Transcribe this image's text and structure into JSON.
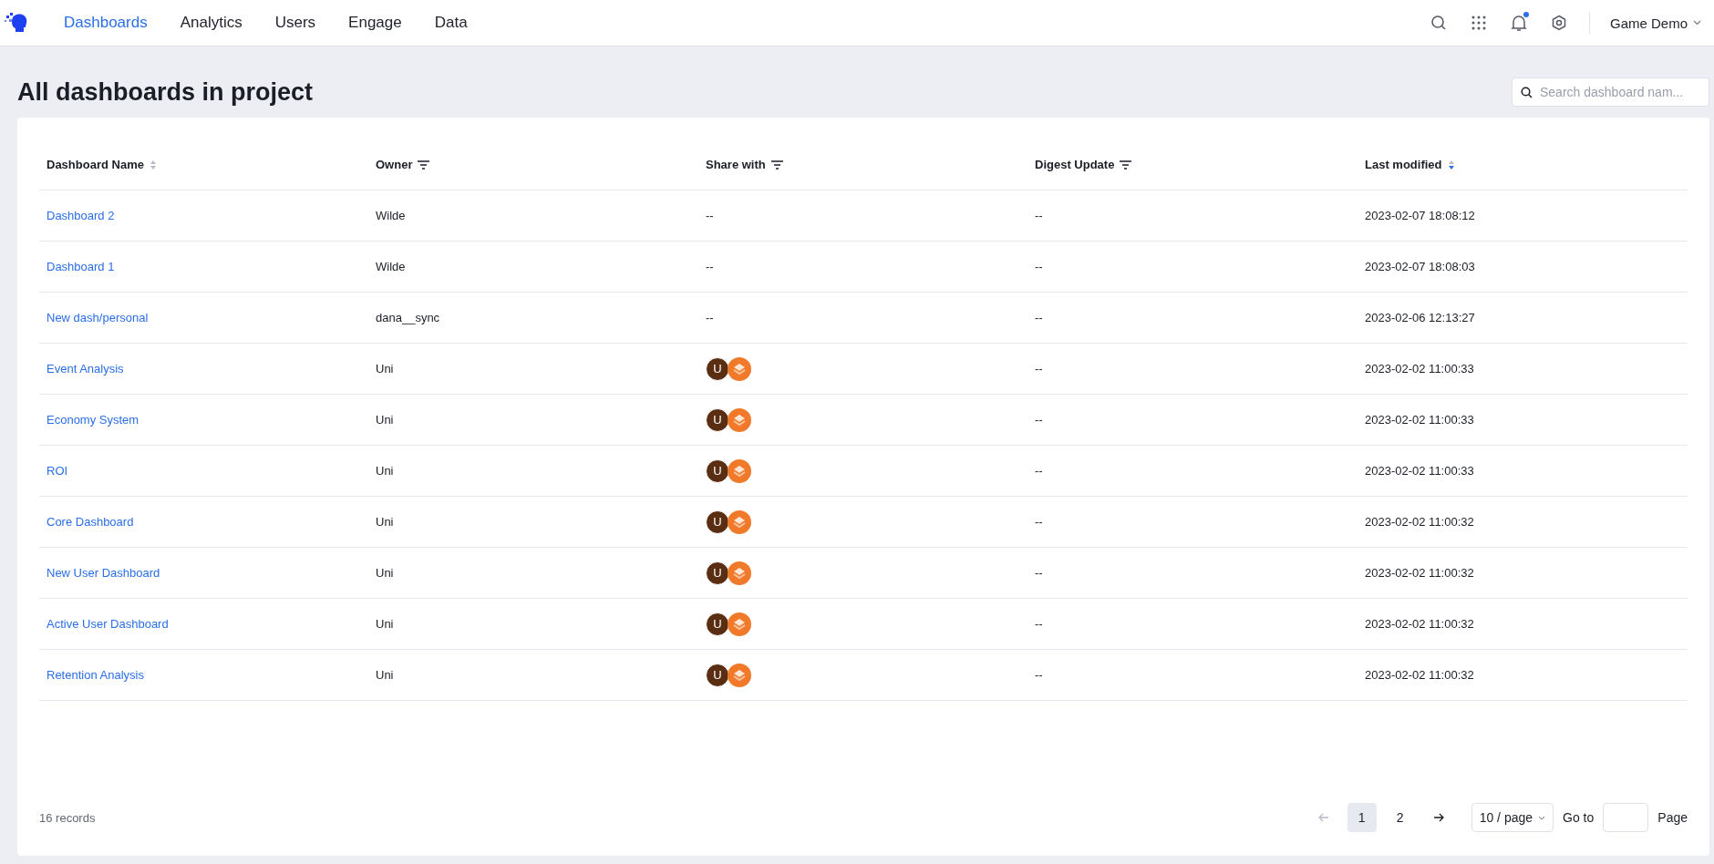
{
  "nav": {
    "items": [
      {
        "label": "Dashboards",
        "selected": true
      },
      {
        "label": "Analytics",
        "selected": false
      },
      {
        "label": "Users",
        "selected": false
      },
      {
        "label": "Engage",
        "selected": false
      },
      {
        "label": "Data",
        "selected": false
      }
    ],
    "notification_unread": true,
    "project": "Game Demo"
  },
  "page": {
    "title": "All dashboards in project",
    "search": {
      "placeholder": "Search dashboard nam..."
    }
  },
  "table": {
    "columns": [
      {
        "label": "Dashboard Name",
        "kind": "sort",
        "sorted_descending": false
      },
      {
        "label": "Owner",
        "kind": "filter"
      },
      {
        "label": "Share with",
        "kind": "filter"
      },
      {
        "label": "Digest Update",
        "kind": "filter"
      },
      {
        "label": "Last modified",
        "kind": "sort",
        "sorted_descending": true
      }
    ],
    "rows": [
      {
        "name": "Dashboard 2",
        "owner": "Wilde",
        "share_text": "--",
        "digest": "--",
        "modified": "2023-02-07 18:08:12"
      },
      {
        "name": "Dashboard 1",
        "owner": "Wilde",
        "share_text": "--",
        "digest": "--",
        "modified": "2023-02-07 18:08:03"
      },
      {
        "name": "New dash/personal",
        "owner": "dana__sync",
        "share_text": "--",
        "digest": "--",
        "modified": "2023-02-06 12:13:27"
      },
      {
        "name": "Event Analysis",
        "owner": "Uni",
        "share_avatars": [
          {
            "kind": "user",
            "initial": "U"
          },
          {
            "kind": "app"
          }
        ],
        "digest": "--",
        "modified": "2023-02-02 11:00:33"
      },
      {
        "name": "Economy System",
        "owner": "Uni",
        "share_avatars": [
          {
            "kind": "user",
            "initial": "U"
          },
          {
            "kind": "app"
          }
        ],
        "digest": "--",
        "modified": "2023-02-02 11:00:33"
      },
      {
        "name": "ROI",
        "owner": "Uni",
        "share_avatars": [
          {
            "kind": "user",
            "initial": "U"
          },
          {
            "kind": "app"
          }
        ],
        "digest": "--",
        "modified": "2023-02-02 11:00:33"
      },
      {
        "name": "Core Dashboard",
        "owner": "Uni",
        "share_avatars": [
          {
            "kind": "user",
            "initial": "U"
          },
          {
            "kind": "app"
          }
        ],
        "digest": "--",
        "modified": "2023-02-02 11:00:32"
      },
      {
        "name": "New User Dashboard",
        "owner": "Uni",
        "share_avatars": [
          {
            "kind": "user",
            "initial": "U"
          },
          {
            "kind": "app"
          }
        ],
        "digest": "--",
        "modified": "2023-02-02 11:00:32"
      },
      {
        "name": "Active User Dashboard",
        "owner": "Uni",
        "share_avatars": [
          {
            "kind": "user",
            "initial": "U"
          },
          {
            "kind": "app"
          }
        ],
        "digest": "--",
        "modified": "2023-02-02 11:00:32"
      },
      {
        "name": "Retention Analysis",
        "owner": "Uni",
        "share_avatars": [
          {
            "kind": "user",
            "initial": "U"
          },
          {
            "kind": "app"
          }
        ],
        "digest": "--",
        "modified": "2023-02-02 11:00:32"
      }
    ]
  },
  "footer": {
    "records": "16 records",
    "pages": [
      {
        "label": "1",
        "selected": true
      },
      {
        "label": "2",
        "selected": false
      }
    ],
    "prev_disabled": true,
    "next_disabled": false,
    "page_size": "10 / page",
    "goto_label": "Go to",
    "page_label": "Page"
  }
}
